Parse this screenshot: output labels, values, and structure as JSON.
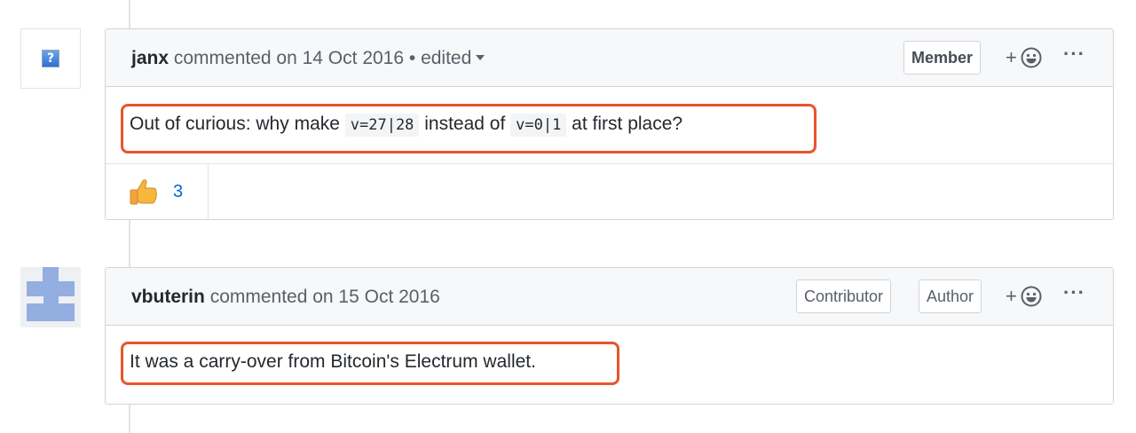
{
  "comments": [
    {
      "author": "janx",
      "meta": "commented on 14 Oct 2016",
      "edited_label": "• edited",
      "badges": [
        "Member"
      ],
      "body_parts": [
        "Out of curious: why make ",
        "v=27|28",
        " instead of ",
        "v=0|1",
        " at first place?"
      ],
      "reactions": [
        {
          "emoji": "thumbs-up-icon",
          "count": "3"
        }
      ]
    },
    {
      "author": "vbuterin",
      "meta": "commented on 15 Oct 2016",
      "badges": [
        "Contributor",
        "Author"
      ],
      "body_parts": [
        "It was a carry-over from Bitcoin's Electrum wallet."
      ]
    }
  ],
  "icons": {
    "add_reaction": "smiley-icon",
    "more": "kebab-horizontal-icon",
    "default_avatar": "question-mark-icon"
  },
  "colors": {
    "highlight": "#e8542e",
    "link": "#0366d6",
    "header_bg": "#f6f8fa",
    "border": "#d1d5da",
    "identicon": "#93aee0"
  },
  "labels": {
    "add_reaction_plus": "+",
    "more_dots": "···",
    "avatar_glyph": "?"
  }
}
